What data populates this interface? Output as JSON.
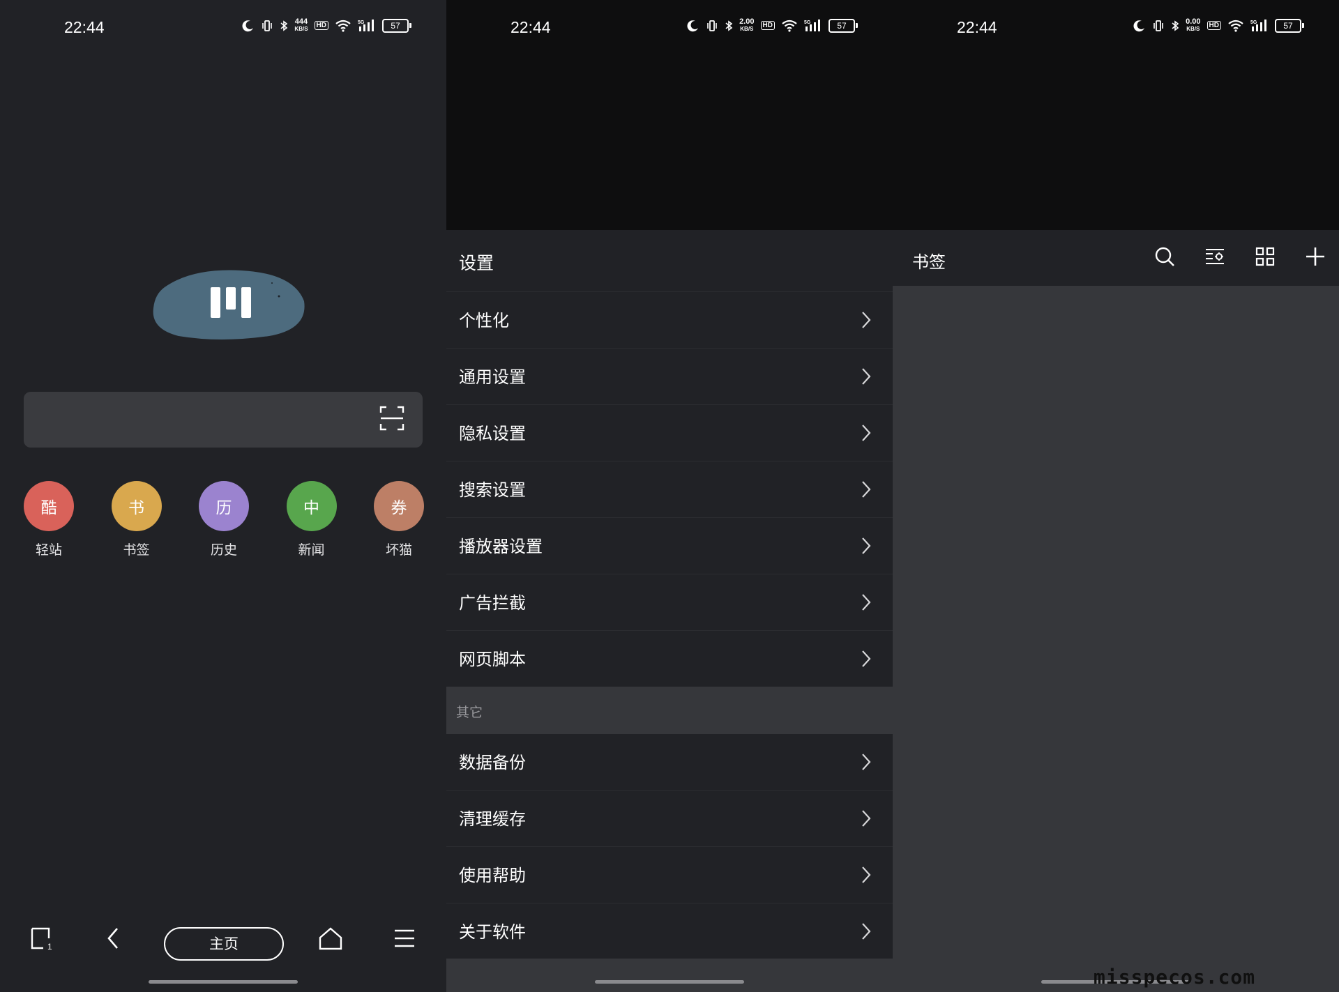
{
  "status_bar": [
    {
      "time": "22:44",
      "speed_top": "444",
      "speed_unit": "KB/S",
      "hd": "HD",
      "signal": "5G",
      "battery": "57"
    },
    {
      "time": "22:44",
      "speed_top": "2.00",
      "speed_unit": "KB/S",
      "hd": "HD",
      "signal": "5G",
      "battery": "57"
    },
    {
      "time": "22:44",
      "speed_top": "0.00",
      "speed_unit": "KB/S",
      "hd": "HD",
      "signal": "5G",
      "battery": "57"
    }
  ],
  "home": {
    "shortcuts": [
      {
        "glyph": "酷",
        "label": "轻站",
        "color": "#d9625a"
      },
      {
        "glyph": "书",
        "label": "书签",
        "color": "#d9a84e"
      },
      {
        "glyph": "历",
        "label": "历史",
        "color": "#9b83cf"
      },
      {
        "glyph": "中",
        "label": "新闻",
        "color": "#58a64d"
      },
      {
        "glyph": "券",
        "label": "坏猫",
        "color": "#bd7f66"
      }
    ],
    "tab_count": "1",
    "home_label": "主页"
  },
  "settings": {
    "title": "设置",
    "items": [
      "个性化",
      "通用设置",
      "隐私设置",
      "搜索设置",
      "播放器设置",
      "广告拦截",
      "网页脚本"
    ],
    "section_label": "其它",
    "other_items": [
      "数据备份",
      "清理缓存",
      "使用帮助",
      "关于软件"
    ]
  },
  "bookmarks": {
    "title": "书签"
  },
  "watermark": "misspecos.com",
  "colors": {
    "panel_bg": "#212226",
    "sheet_section_bg": "#36373b",
    "logo_blob": "#4d6b7e"
  }
}
